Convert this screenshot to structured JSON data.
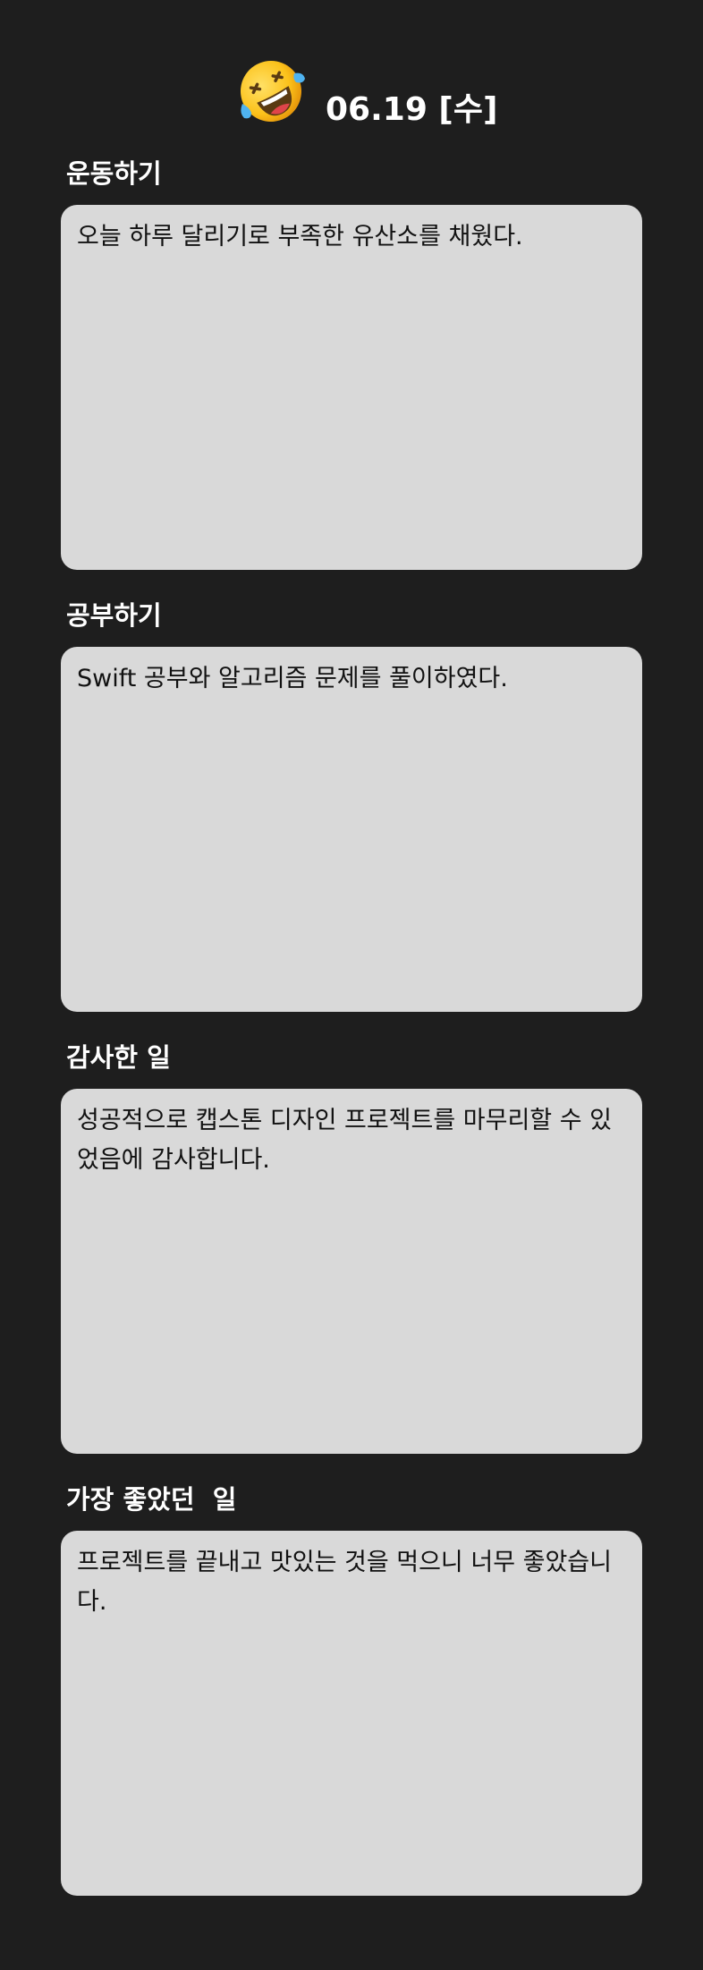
{
  "header": {
    "emoji_icon": "rolling-on-the-floor-laughing-emoji",
    "date_label": "06.19 [수]"
  },
  "sections": [
    {
      "label": "운동하기",
      "text": "오늘 하루 달리기로 부족한 유산소를 채웠다."
    },
    {
      "label": "공부하기",
      "text": "Swift 공부와 알고리즘 문제를 풀이하였다."
    },
    {
      "label": "감사한 일",
      "text": "성공적으로 캡스톤 디자인 프로젝트를 마무리할 수 있었음에 감사합니다."
    },
    {
      "label": "가장 좋았던  일",
      "text": "프로젝트를 끝내고 맛있는 것을 먹으니 너무 좋았습니다."
    }
  ],
  "colors": {
    "background": "#1e1e1e",
    "card": "#d9d9d9",
    "heading_text": "#ffffff",
    "body_text": "#111111"
  }
}
